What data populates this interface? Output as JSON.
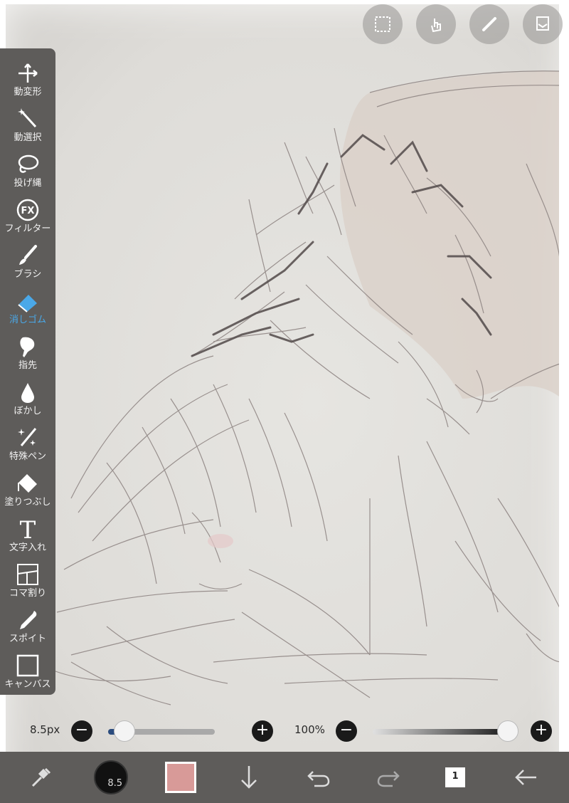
{
  "toolbar": {
    "items": [
      {
        "label": "動変形",
        "icon": "move-transform-icon"
      },
      {
        "label": "動選択",
        "icon": "magic-wand-icon"
      },
      {
        "label": "投げ縄",
        "icon": "lasso-icon"
      },
      {
        "label": "フィルター",
        "icon": "fx-icon"
      },
      {
        "label": "ブラシ",
        "icon": "brush-icon"
      },
      {
        "label": "消しゴム",
        "icon": "eraser-icon",
        "active": true
      },
      {
        "label": "指先",
        "icon": "finger-smudge-icon"
      },
      {
        "label": "ぼかし",
        "icon": "blur-drop-icon"
      },
      {
        "label": "特殊ペン",
        "icon": "special-pen-icon"
      },
      {
        "label": "塗りつぶし",
        "icon": "fill-bucket-icon"
      },
      {
        "label": "文字入れ",
        "icon": "text-icon"
      },
      {
        "label": "コマ割り",
        "icon": "frame-divider-icon"
      },
      {
        "label": "スポイト",
        "icon": "eyedropper-icon"
      },
      {
        "label": "キャンバス",
        "icon": "canvas-icon"
      }
    ],
    "active_color": "#4aa8e8"
  },
  "top_buttons": [
    "selection-icon",
    "touch-icon",
    "ruler-icon",
    "layer-panel-icon"
  ],
  "brush_size": {
    "value": "8.5px",
    "level": 0.15
  },
  "opacity": {
    "value": "100%",
    "level": 1.0
  },
  "bottom_bar": {
    "brush_badge": "8.5",
    "layer_number": "1",
    "color": "#d89a98"
  },
  "colors": {
    "bar": "#5e5c5a",
    "canvas": "#e3e2df",
    "line": "#8a7f7d",
    "skin_tint": "#d8cfc8"
  }
}
